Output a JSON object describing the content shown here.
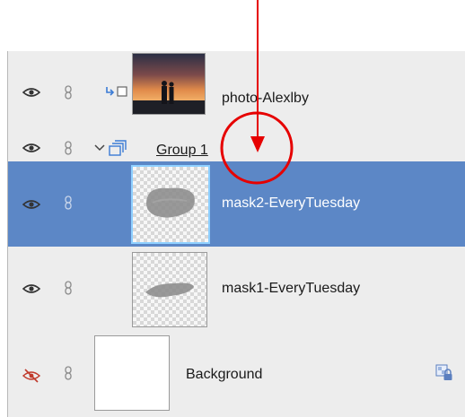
{
  "layers": [
    {
      "name": "photo-Alexlby",
      "visible": true,
      "selected": false,
      "thumbnail": "sunset-couple-photo"
    },
    {
      "name": "Group 1",
      "visible": true,
      "selected": false,
      "type": "group",
      "expanded": true
    },
    {
      "name": "mask2-EveryTuesday",
      "visible": true,
      "selected": true,
      "thumbnail": "gray-brush-stroke-mask"
    },
    {
      "name": "mask1-EveryTuesday",
      "visible": true,
      "selected": false,
      "thumbnail": "gray-brush-stroke-mask"
    },
    {
      "name": "Background",
      "visible": false,
      "selected": false,
      "locked": true,
      "thumbnail": "white-fill"
    }
  ],
  "icons": {
    "visibility": "eye-icon",
    "hidden_visibility": "eye-slash-icon",
    "link": "chain-link-icon",
    "clipping": "clipping-mask-icon",
    "group": "folder-group-icon",
    "lock": "lock-icon"
  },
  "colors": {
    "panel_bg": "#ededed",
    "selected_row": "#5c87c6",
    "selected_thumb_border": "#8fd0ff",
    "annotation": "#e60000"
  }
}
